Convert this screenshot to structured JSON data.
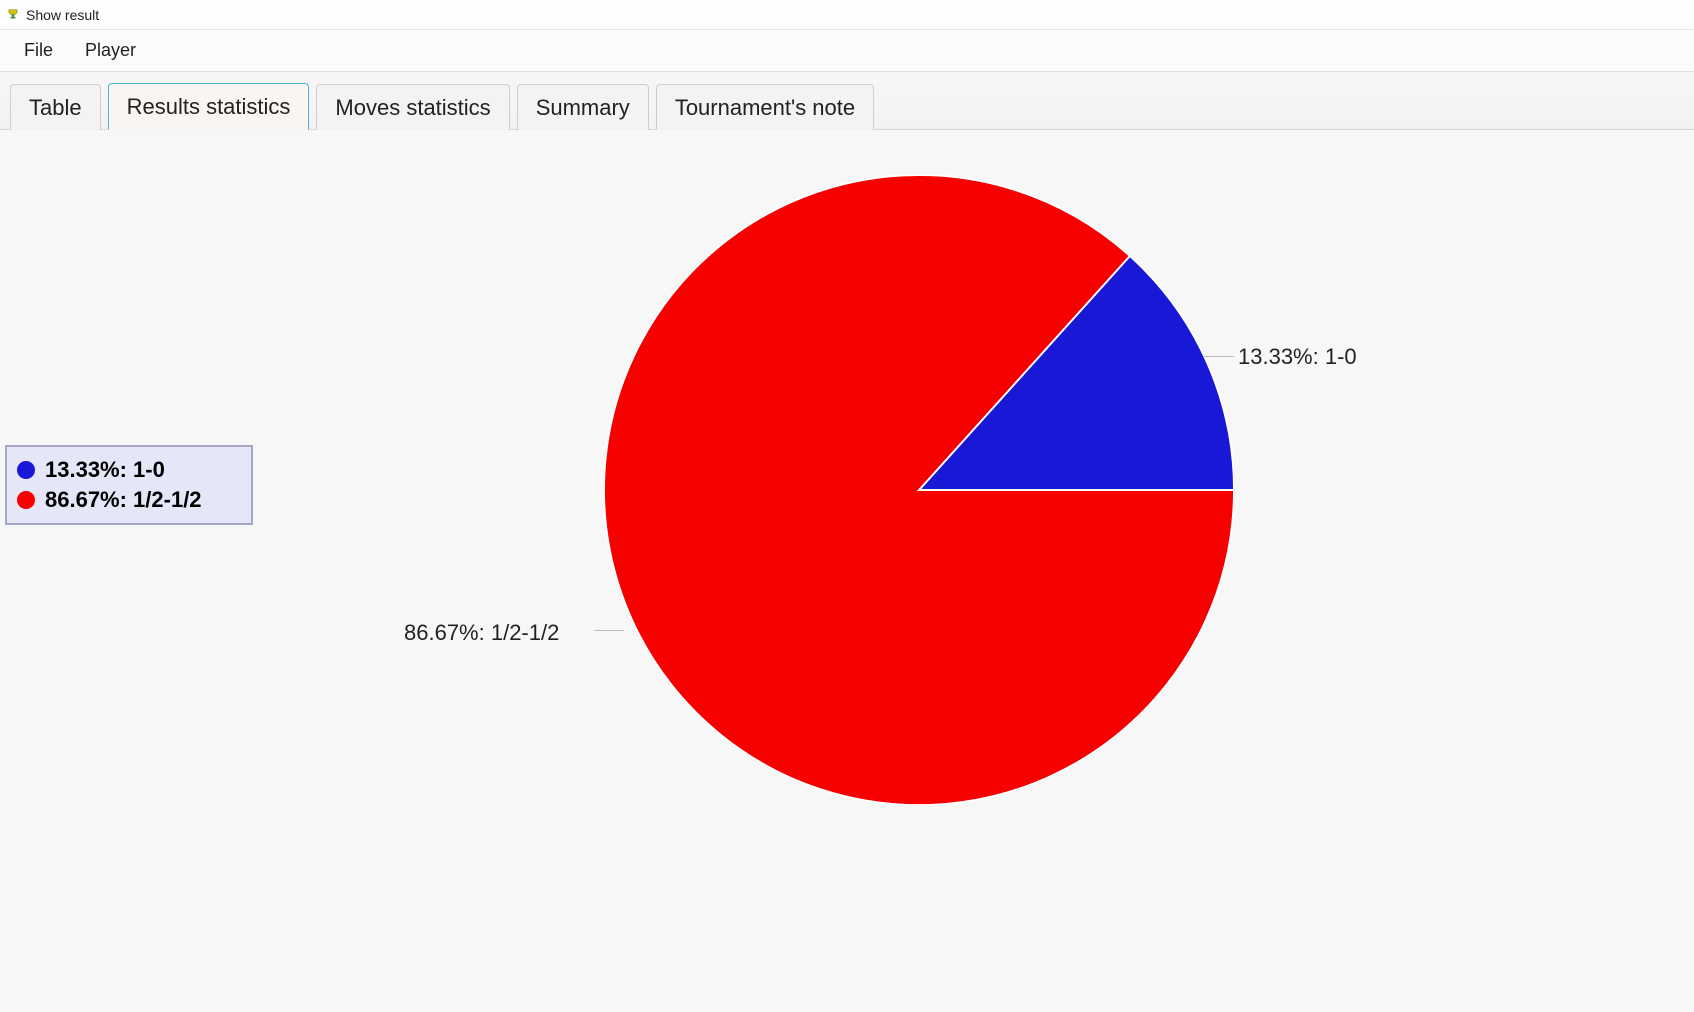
{
  "window": {
    "title": "Show result"
  },
  "menu": {
    "file": "File",
    "player": "Player"
  },
  "tabs": {
    "table": "Table",
    "results": "Results statistics",
    "moves": "Moves statistics",
    "summary": "Summary",
    "note": "Tournament's note",
    "active": "results"
  },
  "legend": {
    "items": [
      {
        "color": "#1818d6",
        "text": "13.33%:  1-0"
      },
      {
        "color": "#f60000",
        "text": "86.67%:  1/2-1/2"
      }
    ]
  },
  "slice_labels": {
    "right": "13.33%:   1-0",
    "left": "86.67%:   1/2-1/2"
  },
  "chart_data": {
    "type": "pie",
    "title": "",
    "series": [
      {
        "name": "1-0",
        "value": 13.33,
        "color": "#1818d6"
      },
      {
        "name": "1/2-1/2",
        "value": 86.67,
        "color": "#f60000"
      }
    ]
  }
}
